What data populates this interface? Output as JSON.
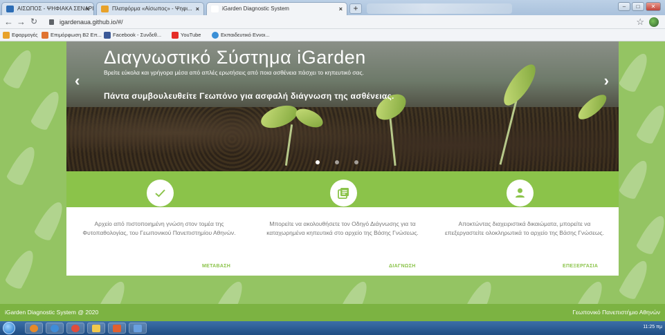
{
  "tabs": [
    {
      "title": "ΑΙΣΩΠΟΣ - ΨΗΦΙΑΚΑ ΣΕΝΑΡΙΑ",
      "color": "#2d6db5"
    },
    {
      "title": "Πλατφόρμα «Αίσωπος» - Ψηφι...",
      "color": "#e8a22a"
    },
    {
      "title": "iGarden Diagnostic System",
      "color": "#ffffff"
    }
  ],
  "address": {
    "url": "igardenaua.github.io/#/"
  },
  "bookmarks": [
    {
      "label": "Εφαρμογές",
      "color": "#e8a22a"
    },
    {
      "label": "Επιμόρφωση Β2 Επ...",
      "color": "#e0722f"
    },
    {
      "label": "Facebook - Συνδεθ...",
      "color": "#3b5998"
    },
    {
      "label": "YouTube",
      "color": "#e52d27"
    },
    {
      "label": "Εκπαιδευτικό Εννοι...",
      "color": "#3a8fd6"
    }
  ],
  "hero": {
    "title": "Διαγνωστικό Σύστημα iGarden",
    "subtitle": "Βρείτε εύκολα και γρήγορα μέσα από απλές ερωτήσεις από ποια ασθένεια πάσχει το κηπευτικό σας.",
    "tip": "Πάντα συμβουλευθείτε Γεωπόνο για ασφαλή διάγνωση της ασθένειας.",
    "prev": "‹",
    "next": "›"
  },
  "features": [
    {
      "icon": "check-icon",
      "text": "Αρχείο από πιστοποιημένη γνώση στον τομέα της Φυτοπαθολογίας, του Γεωπονικού Πανεπιστημίου Αθηνών.",
      "link": "ΜΕΤΑΒΑΣΗ"
    },
    {
      "icon": "library-icon",
      "text": "Μπορείτε να ακολουθήσετε τον Οδηγό Διάγνωσης για τα καταχωρημένα κηπευτικά στο αρχείο της Βάσης Γνώσεως.",
      "link": "ΔΙΑΓΝΩΣΗ"
    },
    {
      "icon": "person-icon",
      "text": "Αποκτώντας διαχειριστικά δικαιώματα, μπορείτε να επεξεργαστείτε ολοκληρωτικά το αρχείο της Βάσης Γνώσεως.",
      "link": "ΕΠΕΞΕΡΓΑΣΙΑ"
    }
  ],
  "footer": {
    "left": "iGarden Diagnostic System @ 2020",
    "right": "Γεωπονικό Πανεπιστήμιο Αθηνών"
  },
  "tray": {
    "clock": "11:25 πμ"
  },
  "colors": {
    "accent": "#8bc34a",
    "footer": "#7cb342"
  }
}
